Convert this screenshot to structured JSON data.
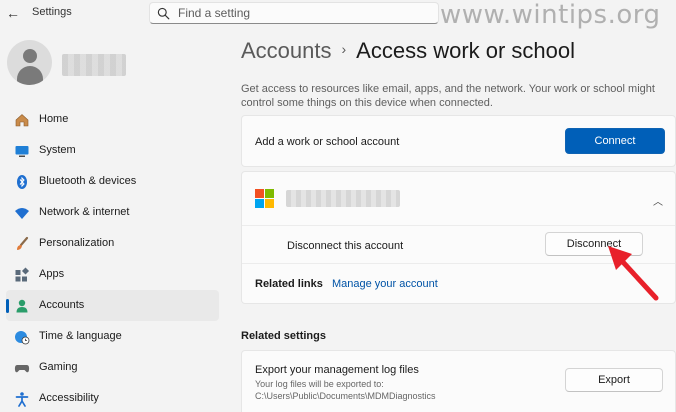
{
  "window": {
    "app_title": "Settings",
    "back_glyph": "←"
  },
  "search": {
    "placeholder": "Find a setting"
  },
  "watermark": "www.wintips.org",
  "sidebar": {
    "items": [
      {
        "label": "Home",
        "icon": "home-icon"
      },
      {
        "label": "System",
        "icon": "system-icon"
      },
      {
        "label": "Bluetooth & devices",
        "icon": "bluetooth-icon"
      },
      {
        "label": "Network & internet",
        "icon": "wifi-icon"
      },
      {
        "label": "Personalization",
        "icon": "brush-icon"
      },
      {
        "label": "Apps",
        "icon": "apps-icon"
      },
      {
        "label": "Accounts",
        "icon": "accounts-icon",
        "active": true
      },
      {
        "label": "Time & language",
        "icon": "globe-clock-icon"
      },
      {
        "label": "Gaming",
        "icon": "gamepad-icon"
      },
      {
        "label": "Accessibility",
        "icon": "accessibility-icon"
      }
    ]
  },
  "header": {
    "parent": "Accounts",
    "separator": "›",
    "title": "Access work or school"
  },
  "description": "Get access to resources like email, apps, and the network. Your work or school might control some things on this device when connected.",
  "add_account": {
    "label": "Add a work or school account",
    "button": "Connect"
  },
  "account": {
    "chevron": "︿",
    "disconnect_label": "Disconnect this account",
    "disconnect_button": "Disconnect",
    "related_links_label": "Related links",
    "manage_link": "Manage your account"
  },
  "related_settings": {
    "title": "Related settings",
    "export_label": "Export your management log files",
    "export_sub": "Your log files will be exported to: C:\\Users\\Public\\Documents\\MDMDiagnostics",
    "export_button": "Export"
  },
  "colors": {
    "accent": "#005fb8",
    "link": "#0053a6",
    "annotation_arrow": "#e8202a",
    "ms_red": "#f25022",
    "ms_green": "#7fba00",
    "ms_blue": "#00a4ef",
    "ms_yellow": "#ffb900"
  }
}
